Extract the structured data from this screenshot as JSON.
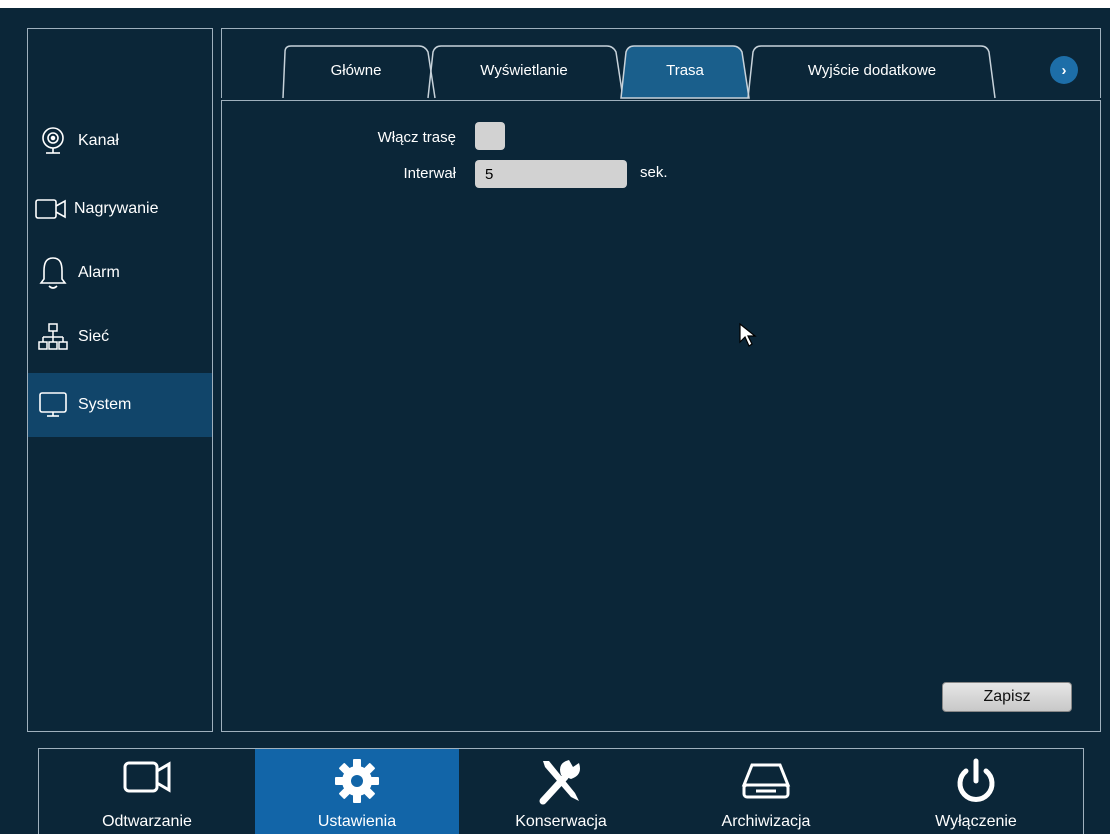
{
  "sidebar": {
    "items": [
      {
        "label": "Kanał",
        "icon": "camera-lens-icon"
      },
      {
        "label": "Nagrywanie",
        "icon": "video-camera-icon"
      },
      {
        "label": "Alarm",
        "icon": "bell-icon"
      },
      {
        "label": "Sieć",
        "icon": "network-icon"
      },
      {
        "label": "System",
        "icon": "monitor-icon",
        "active": true
      }
    ]
  },
  "tabs": {
    "items": [
      {
        "label": "Główne"
      },
      {
        "label": "Wyświetlanie"
      },
      {
        "label": "Trasa",
        "active": true
      },
      {
        "label": "Wyjście dodatkowe"
      }
    ],
    "next_glyph": "›"
  },
  "form": {
    "enable_label": "Włącz trasę",
    "enable_checked": false,
    "interval_label": "Interwał",
    "interval_value": "5",
    "interval_unit": "sek."
  },
  "save_label": "Zapisz",
  "bottom_bar": {
    "items": [
      {
        "label": "Odtwarzanie",
        "icon": "video-camera-icon"
      },
      {
        "label": "Ustawienia",
        "icon": "gear-icon",
        "active": true
      },
      {
        "label": "Konserwacja",
        "icon": "tools-icon"
      },
      {
        "label": "Archiwizacja",
        "icon": "storage-drive-icon"
      },
      {
        "label": "Wyłączenie",
        "icon": "power-icon"
      }
    ]
  },
  "colors": {
    "background": "#0b2638",
    "active_sidebar": "#11456a",
    "active_tab": "#1a5f8c",
    "active_bottom": "#1265a8",
    "border": "#9fb0bd"
  }
}
